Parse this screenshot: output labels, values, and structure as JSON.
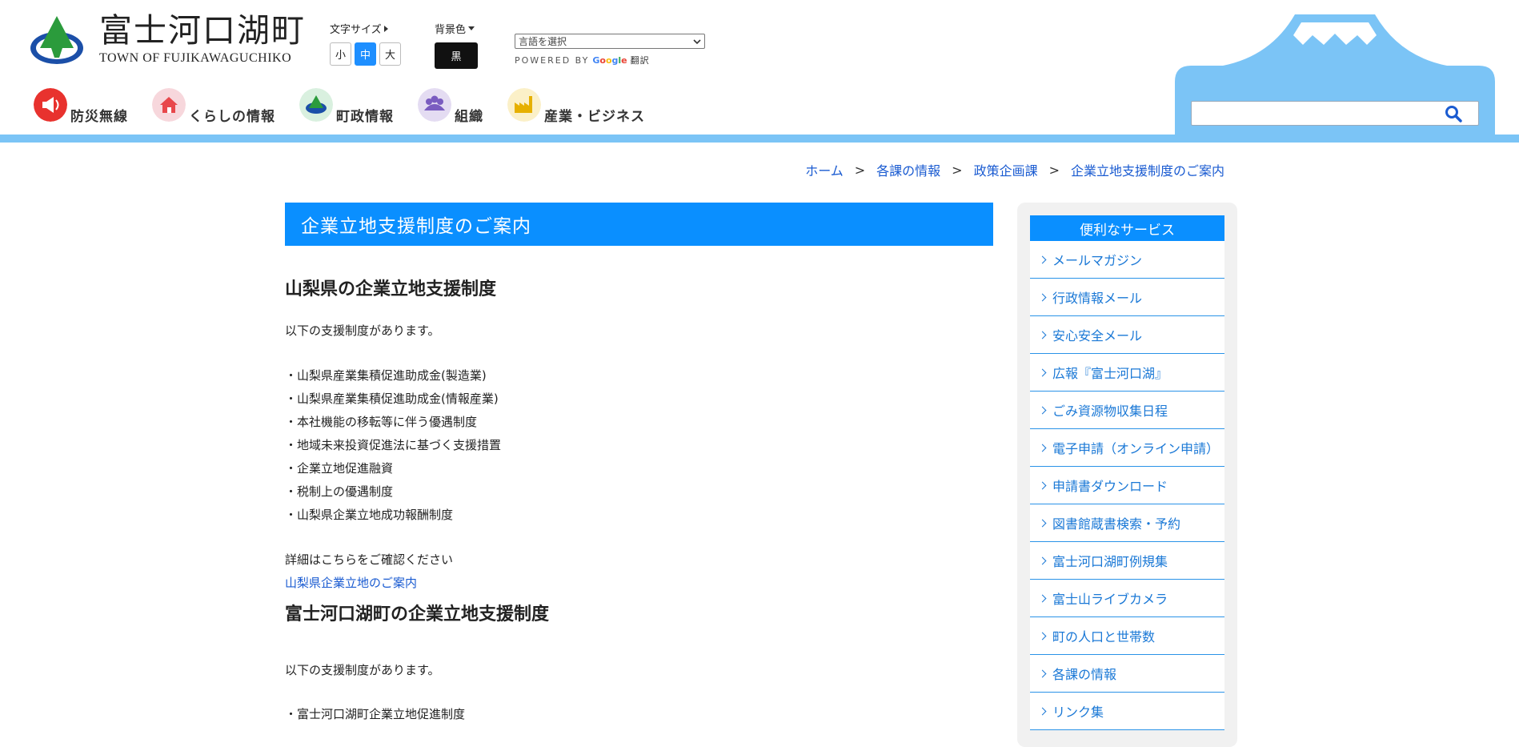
{
  "header": {
    "logo_jp": "富士河口湖町",
    "logo_en": "TOWN OF FUJIKAWAGUCHIKO",
    "font_size": {
      "label": "文字サイズ",
      "options": [
        "小",
        "中",
        "大"
      ],
      "selected": "中"
    },
    "bg_color": {
      "label": "背景色",
      "button": "黒"
    },
    "translate": {
      "select_value": "言語を選択",
      "powered_by": "POWERED BY",
      "google": "Google",
      "translate_word": "翻訳"
    },
    "nav": [
      {
        "label": "防災無線",
        "icon": "megaphone-icon",
        "color": "#e8322e"
      },
      {
        "label": "くらしの情報",
        "icon": "house-icon",
        "color": "#f7d7dc"
      },
      {
        "label": "町政情報",
        "icon": "town-icon",
        "color": "#d9f0df"
      },
      {
        "label": "組織",
        "icon": "people-icon",
        "color": "#e4dcf2"
      },
      {
        "label": "産業・ビジネス",
        "icon": "factory-icon",
        "color": "#fbf0c8"
      }
    ],
    "search": {
      "placeholder": ""
    },
    "accent_color": "#0a8fff",
    "band_color": "#7bc4f6"
  },
  "breadcrumb": [
    "ホーム",
    "各課の情報",
    "政策企画課",
    "企業立地支援制度のご案内"
  ],
  "main": {
    "title": "企業立地支援制度のご案内",
    "section1": {
      "heading": "山梨県の企業立地支援制度",
      "intro": "以下の支援制度があります。",
      "items": [
        "・山梨県産業集積促進助成金(製造業)",
        "・山梨県産業集積促進助成金(情報産業)",
        "・本社機能の移転等に伴う優遇制度",
        "・地域未来投資促進法に基づく支援措置",
        "・企業立地促進融資",
        "・税制上の優遇制度",
        "・山梨県企業立地成功報酬制度"
      ],
      "detail": "詳細はこちらをご確認ください",
      "link": "山梨県企業立地のご案内"
    },
    "section2": {
      "heading": "富士河口湖町の企業立地支援制度",
      "intro": "以下の支援制度があります。",
      "items": [
        "・富士河口湖町企業立地促進制度"
      ]
    }
  },
  "sidebar": {
    "title": "便利なサービス",
    "items": [
      "メールマガジン",
      "行政情報メール",
      "安心安全メール",
      "広報『富士河口湖』",
      "ごみ資源物収集日程",
      "電子申請（オンライン申請）",
      "申請書ダウンロード",
      "図書館蔵書検索・予約",
      "富士河口湖町例規集",
      "富士山ライブカメラ",
      "町の人口と世帯数",
      "各課の情報",
      "リンク集"
    ]
  }
}
